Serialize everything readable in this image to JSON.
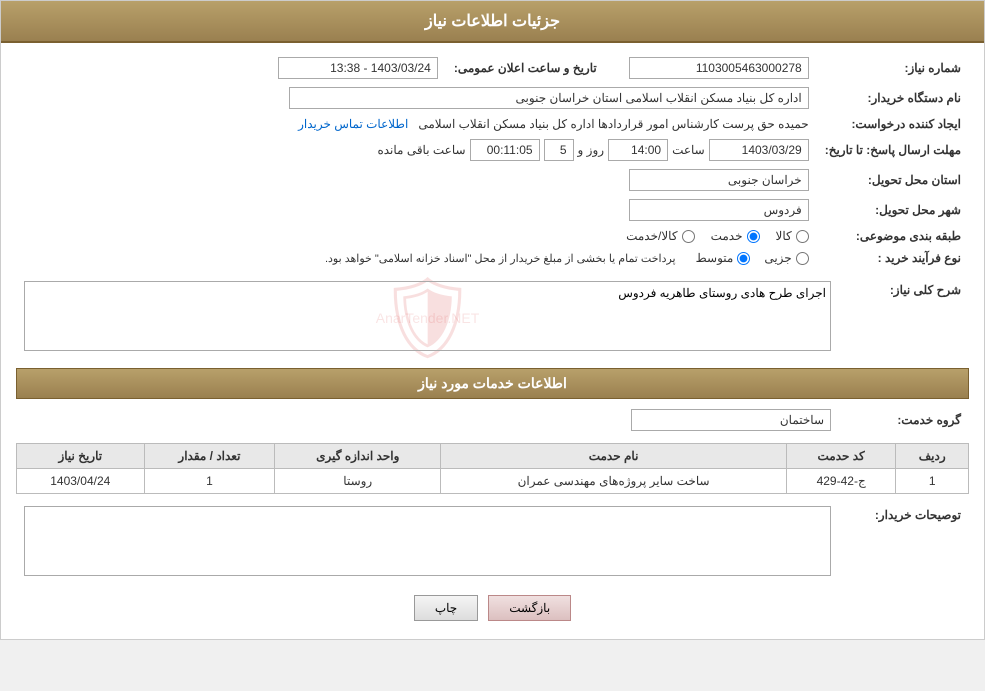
{
  "page": {
    "title": "جزئیات اطلاعات نیاز"
  },
  "header": {
    "announcement_label": "تاریخ و ساعت اعلان عمومی:",
    "announcement_value": "1403/03/24 - 13:38",
    "need_number_label": "شماره نیاز:",
    "need_number_value": "1103005463000278",
    "buyer_name_label": "نام دستگاه خریدار:",
    "buyer_name_value": "اداره کل بنیاد مسکن انقلاب اسلامی استان خراسان جنوبی",
    "creator_label": "ایجاد کننده درخواست:",
    "creator_value": "حمیده حق پرست کارشناس امور قراردادها اداره کل بنیاد مسکن انقلاب اسلامی",
    "contact_link": "اطلاعات تماس خریدار",
    "deadline_label": "مهلت ارسال پاسخ: تا تاریخ:",
    "deadline_date": "1403/03/29",
    "deadline_time_label": "ساعت",
    "deadline_time": "14:00",
    "deadline_days_label": "روز و",
    "deadline_days": "5",
    "remaining_label": "ساعت باقی مانده",
    "remaining_time": "00:11:05",
    "province_label": "استان محل تحویل:",
    "province_value": "خراسان جنوبی",
    "city_label": "شهر محل تحویل:",
    "city_value": "فردوس",
    "category_label": "طبقه بندی موضوعی:",
    "radio_goods": "کالا",
    "radio_service": "خدمت",
    "radio_goods_service": "کالا/خدمت",
    "radio_service_checked": true,
    "purchase_type_label": "نوع فرآیند خرید :",
    "radio_partial": "جزیی",
    "radio_medium": "متوسط",
    "purchase_note": "پرداخت تمام یا بخشی از مبلغ خریدار از محل \"اسناد خزانه اسلامی\" خواهد بود.",
    "general_description_label": "شرح کلی نیاز:",
    "general_description_value": "اجرای طرح هادی روستای طاهریه فردوس"
  },
  "services_section": {
    "title": "اطلاعات خدمات مورد نیاز",
    "service_group_label": "گروه خدمت:",
    "service_group_value": "ساختمان",
    "table_headers": {
      "row_num": "ردیف",
      "service_code": "کد حدمت",
      "service_name": "نام حدمت",
      "unit": "واحد اندازه گیری",
      "quantity": "تعداد / مقدار",
      "date": "تاریخ نیاز"
    },
    "table_rows": [
      {
        "row_num": "1",
        "service_code": "ج-42-429",
        "service_name": "ساخت سایر پروژه‌های مهندسی عمران",
        "unit": "روستا",
        "quantity": "1",
        "date": "1403/04/24"
      }
    ]
  },
  "buyer_notes_label": "توصیحات خریدار:",
  "buttons": {
    "print": "چاپ",
    "back": "بازگشت"
  }
}
